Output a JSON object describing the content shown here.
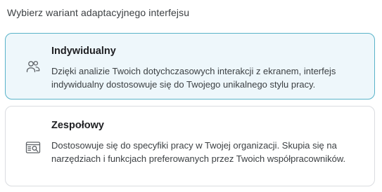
{
  "header": {
    "title": "Wybierz wariant adaptacyjnego interfejsu"
  },
  "options": [
    {
      "title": "Indywidualny",
      "description": "Dzięki analizie Twoich dotychczasowych interakcji z ekranem, interfejs indywidualny dostosowuje się do Twojego unikalnego stylu pracy.",
      "icon": "users-icon",
      "selected": true
    },
    {
      "title": "Zespołowy",
      "description": "Dostosowuje się do specyfiki pracy w Twojej organizacji. Skupia się na narzędziach i funkcjach preferowanych przez Twoich współpracowników.",
      "icon": "team-workspace-icon",
      "selected": false
    }
  ],
  "colors": {
    "selected_background": "#eef7fb",
    "selected_border": "#59b3c9",
    "default_border": "#dadce0"
  }
}
